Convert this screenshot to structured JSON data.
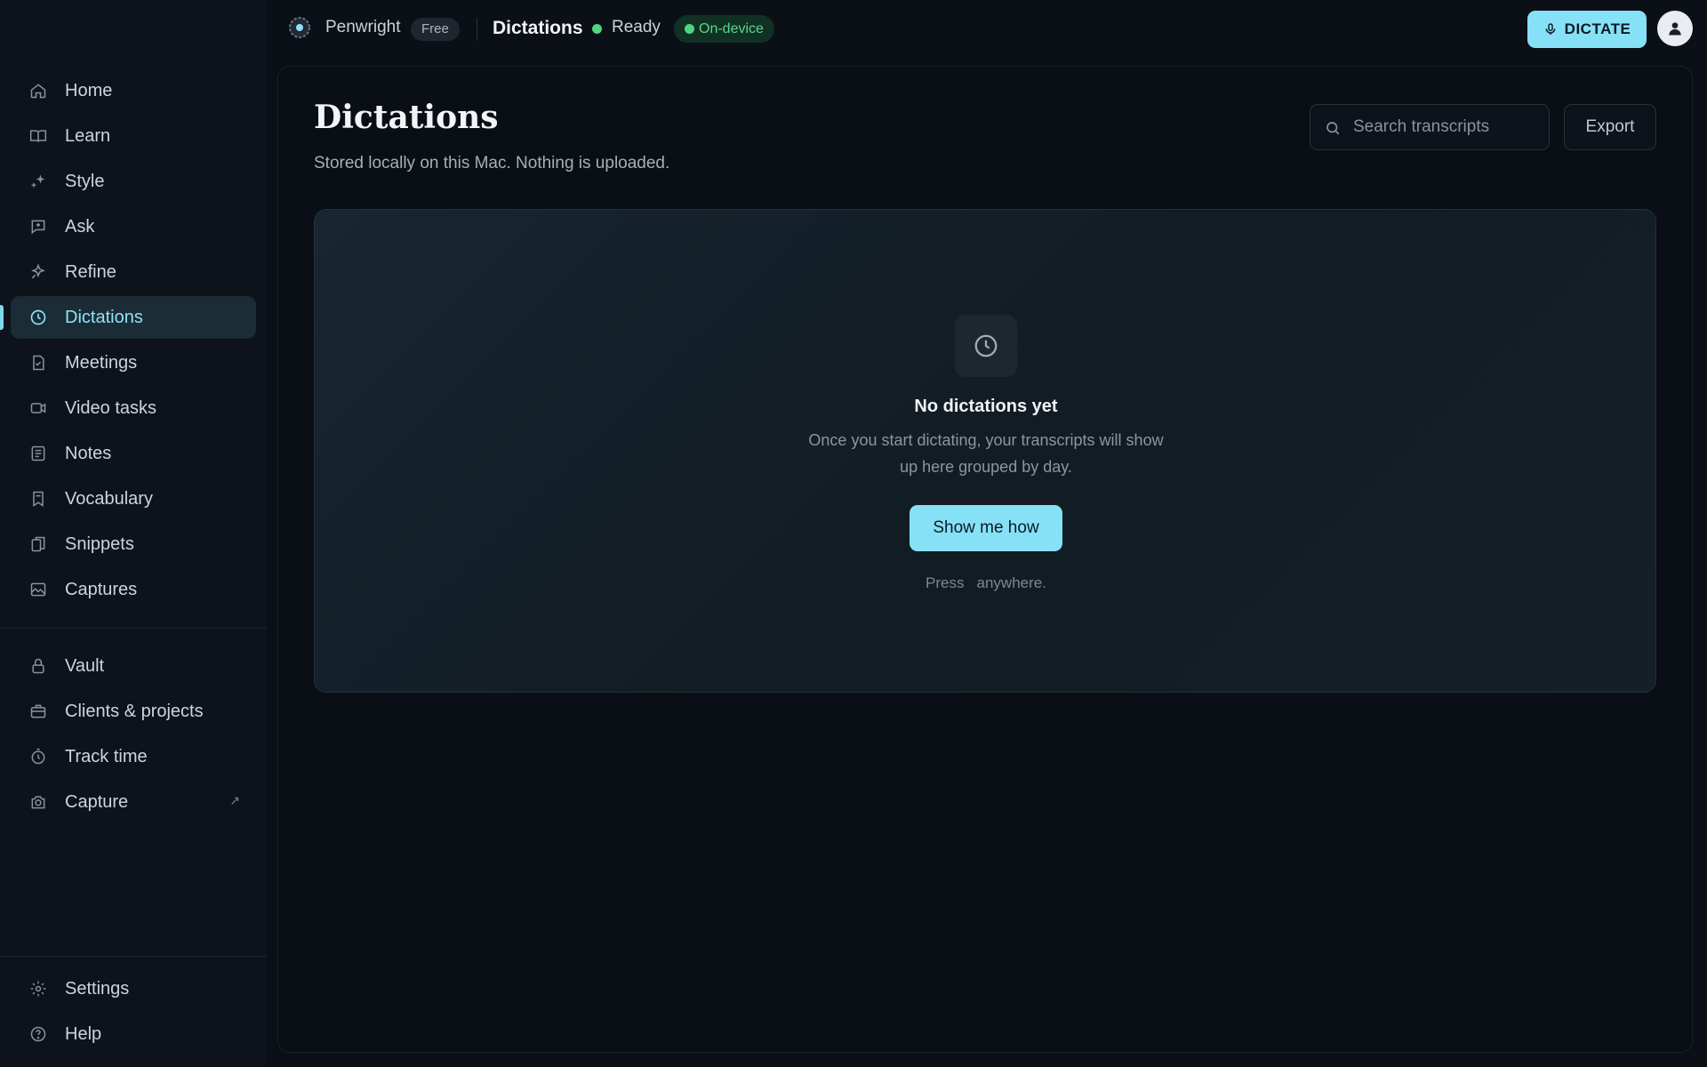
{
  "brand": {
    "name": "Penwright",
    "plan_badge": "Free"
  },
  "topbar": {
    "title": "Dictations",
    "status_text": "Ready",
    "mode_badge": "On-device",
    "dictate_label": "DICTATE"
  },
  "sidebar": {
    "main_items": [
      {
        "label": "Home",
        "icon": "home-icon"
      },
      {
        "label": "Learn",
        "icon": "book-icon"
      },
      {
        "label": "Style",
        "icon": "sparkle-icon"
      },
      {
        "label": "Ask",
        "icon": "chat-icon"
      },
      {
        "label": "Refine",
        "icon": "refine-icon"
      },
      {
        "label": "Dictations",
        "icon": "clock-icon"
      },
      {
        "label": "Meetings",
        "icon": "document-icon"
      },
      {
        "label": "Video tasks",
        "icon": "video-icon"
      },
      {
        "label": "Notes",
        "icon": "notes-icon"
      },
      {
        "label": "Vocabulary",
        "icon": "bookmark-icon"
      },
      {
        "label": "Snippets",
        "icon": "snippets-icon"
      },
      {
        "label": "Captures",
        "icon": "image-icon"
      }
    ],
    "tool_items": [
      {
        "label": "Vault",
        "icon": "lock-icon"
      },
      {
        "label": "Clients & projects",
        "icon": "briefcase-icon"
      },
      {
        "label": "Track time",
        "icon": "timer-icon"
      },
      {
        "label": "Capture",
        "icon": "camera-icon",
        "external_glyph": "↗"
      }
    ],
    "footer_items": [
      {
        "label": "Settings",
        "icon": "gear-icon"
      },
      {
        "label": "Help",
        "icon": "help-icon"
      }
    ],
    "active": "Dictations"
  },
  "main": {
    "title": "Dictations",
    "subtitle": "Stored locally on this Mac. Nothing is uploaded.",
    "search_placeholder": "Search transcripts",
    "export_label": "Export",
    "empty": {
      "title": "No dictations yet",
      "description": "Once you start dictating, your transcripts will show up here grouped by day.",
      "button": "Show me how",
      "hint_before": "Press",
      "hint_after": "anywhere."
    }
  },
  "colors": {
    "accent": "#86e1f6",
    "status_green": "#4fd47f",
    "background": "#0b0f16",
    "sidebar_active": "#1b2c36"
  }
}
